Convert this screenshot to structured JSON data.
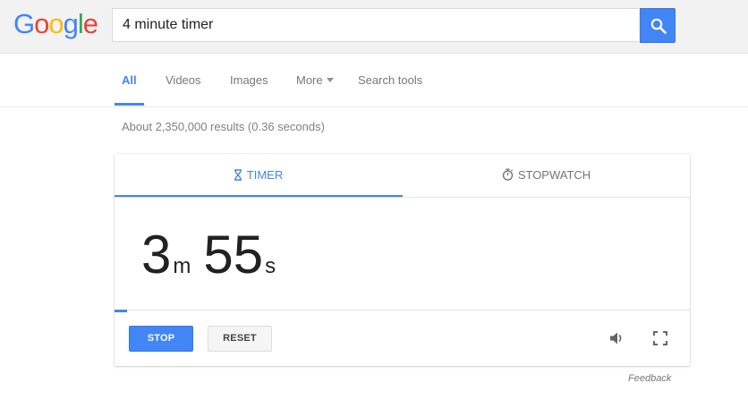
{
  "logo": {
    "letters": [
      "G",
      "o",
      "o",
      "g",
      "l",
      "e"
    ],
    "colors": [
      "#4285f4",
      "#ea4335",
      "#fbbc05",
      "#4285f4",
      "#34a853",
      "#ea4335"
    ]
  },
  "search": {
    "query": "4 minute timer",
    "button_icon": "search-icon"
  },
  "nav": {
    "tabs": [
      {
        "label": "All",
        "active": true
      },
      {
        "label": "Videos"
      },
      {
        "label": "Images"
      },
      {
        "label": "More"
      },
      {
        "label": "Search tools"
      }
    ]
  },
  "results": {
    "stats": "About 2,350,000 results (0.36 seconds)"
  },
  "timer": {
    "tabs": {
      "timer": {
        "label": "TIMER",
        "icon": "hourglass-icon"
      },
      "stopwatch": {
        "label": "STOPWATCH",
        "icon": "stopwatch-icon"
      }
    },
    "minutes": "3",
    "minutes_unit": "m",
    "seconds": "55",
    "seconds_unit": "s",
    "progress_fraction": 0.021,
    "stop_label": "STOP",
    "reset_label": "RESET",
    "sound_icon": "speaker-icon",
    "fullscreen_icon": "fullscreen-icon"
  },
  "feedback_label": "Feedback",
  "colors": {
    "accent": "#4285f4",
    "header_bg": "#f2f2f2",
    "muted_text": "#777777"
  }
}
